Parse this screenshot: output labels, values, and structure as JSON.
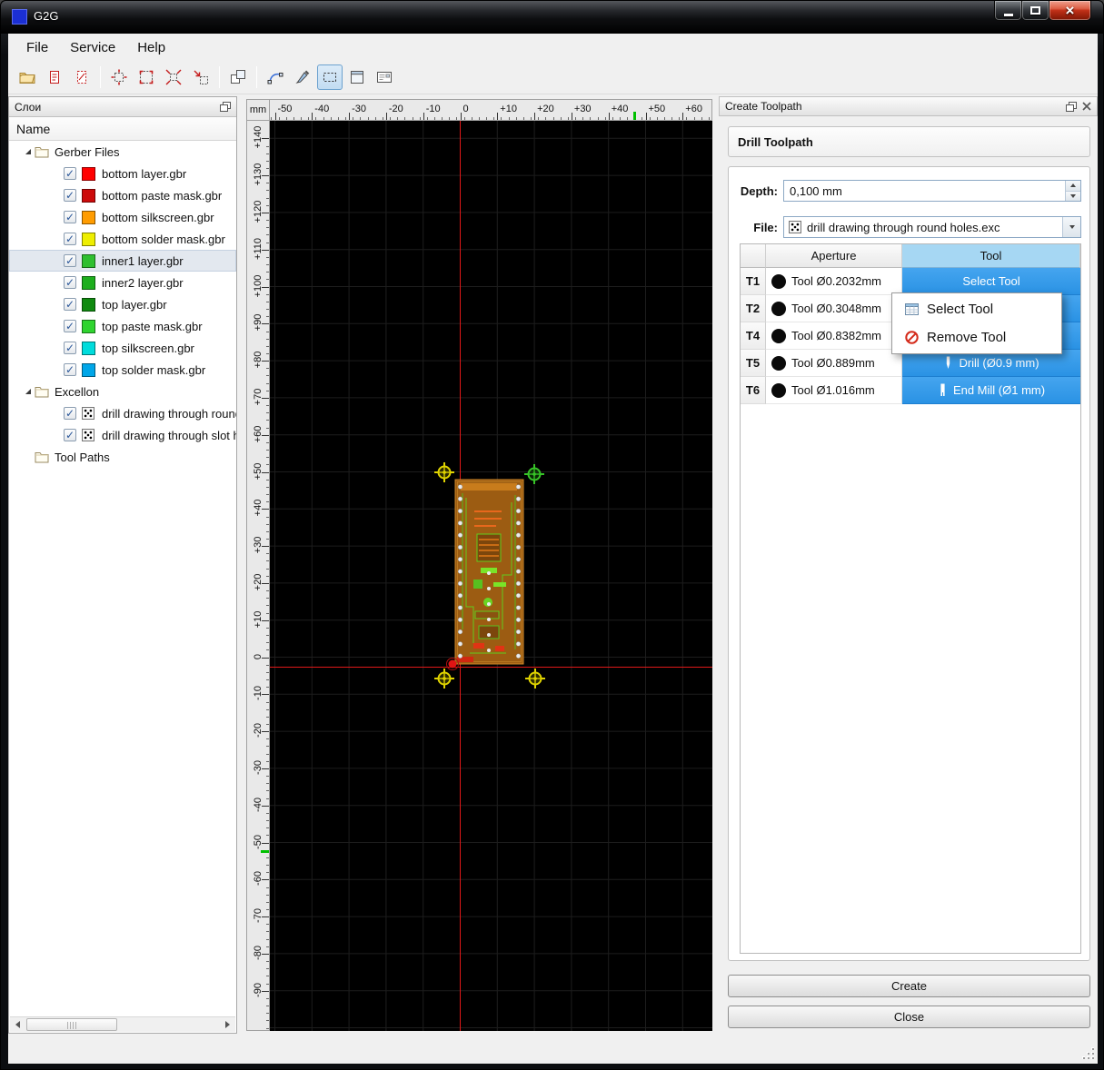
{
  "window": {
    "title": "G2G"
  },
  "menu": {
    "items": [
      "File",
      "Service",
      "Help"
    ]
  },
  "toolbar": {
    "buttons": [
      {
        "name": "open-file-button",
        "icon": "folder"
      },
      {
        "name": "import-gerber-button",
        "icon": "docRed"
      },
      {
        "name": "close-file-button",
        "icon": "docRedDashed"
      },
      {
        "name": "zoom-fit-button",
        "icon": "zoomFit",
        "sep": true
      },
      {
        "name": "zoom-window-button",
        "icon": "zoomWindow"
      },
      {
        "name": "zoom-in-button",
        "icon": "zoomIn"
      },
      {
        "name": "zoom-out-button",
        "icon": "zoomOut"
      },
      {
        "name": "tile-view-button",
        "icon": "tile",
        "sep": true
      },
      {
        "name": "arc-tool-button",
        "icon": "arc",
        "sep": true
      },
      {
        "name": "draw-tool-button",
        "icon": "brush"
      },
      {
        "name": "select-region-button",
        "icon": "marquee",
        "pressed": true
      },
      {
        "name": "frame-view-button",
        "icon": "frame"
      },
      {
        "name": "form-view-button",
        "icon": "form"
      }
    ]
  },
  "layers_panel": {
    "title": "Слои",
    "name_header": "Name",
    "tree": [
      {
        "label": "Gerber Files",
        "type": "folder",
        "expanded": true,
        "children": [
          {
            "label": "bottom layer.gbr",
            "checked": true,
            "swatch": "#ff0000"
          },
          {
            "label": "bottom paste mask.gbr",
            "checked": true,
            "swatch": "#cc0a0a"
          },
          {
            "label": "bottom silkscreen.gbr",
            "checked": true,
            "swatch": "#ff9c00"
          },
          {
            "label": "bottom solder mask.gbr",
            "checked": true,
            "swatch": "#eeee00"
          },
          {
            "label": "inner1 layer.gbr",
            "checked": true,
            "swatch": "#2fbf2f",
            "selected": true
          },
          {
            "label": "inner2 layer.gbr",
            "checked": true,
            "swatch": "#1dae1d"
          },
          {
            "label": "top layer.gbr",
            "checked": true,
            "swatch": "#0f8a0f"
          },
          {
            "label": "top paste mask.gbr",
            "checked": true,
            "swatch": "#2fd42f"
          },
          {
            "label": "top silkscreen.gbr",
            "checked": true,
            "swatch": "#00dcdc"
          },
          {
            "label": "top solder mask.gbr",
            "checked": true,
            "swatch": "#00a6e8"
          }
        ]
      },
      {
        "label": "Excellon",
        "type": "folder",
        "expanded": true,
        "children": [
          {
            "label": "drill drawing through round holes.exc",
            "checked": true,
            "icon": "drill"
          },
          {
            "label": "drill drawing through slot holes.exc",
            "checked": true,
            "icon": "drill"
          }
        ]
      },
      {
        "label": "Tool Paths",
        "type": "folder"
      }
    ]
  },
  "canvas": {
    "unit": "mm",
    "h_ruler": [
      "-50",
      "-40",
      "-30",
      "-20",
      "-10",
      "0",
      "+10",
      "+20",
      "+30",
      "+40",
      "+50",
      "+60"
    ],
    "v_ruler": [
      "+140",
      "+130",
      "+120",
      "+110",
      "+100",
      "+90",
      "+80",
      "+70",
      "+60",
      "+50",
      "+40",
      "+30",
      "+20",
      "+10",
      "0",
      "-10",
      "-20",
      "-30",
      "-40",
      "-50",
      "-60",
      "-70",
      "-80",
      "-90"
    ]
  },
  "toolpath_panel": {
    "title": "Create Toolpath",
    "section_title": "Drill Toolpath",
    "depth_label": "Depth:",
    "depth_value": "0,100 mm",
    "file_label": "File:",
    "file_value": "drill drawing through round holes.exc",
    "table": {
      "aperture_header": "Aperture",
      "tool_header": "Tool",
      "rows": [
        {
          "id": "T1",
          "aperture": "Tool Ø0.2032mm",
          "tool": "Select Tool",
          "tool_icon": ""
        },
        {
          "id": "T2",
          "aperture": "Tool Ø0.3048mm",
          "tool": "",
          "tool_icon": ""
        },
        {
          "id": "T4",
          "aperture": "Tool Ø0.8382mm",
          "tool": "",
          "tool_icon": ""
        },
        {
          "id": "T5",
          "aperture": "Tool Ø0.889mm",
          "tool": "Drill (Ø0.9 mm)",
          "tool_icon": "drill"
        },
        {
          "id": "T6",
          "aperture": "Tool Ø1.016mm",
          "tool": "End Mill (Ø1 mm)",
          "tool_icon": "endmill"
        }
      ]
    },
    "context_menu": {
      "items": [
        {
          "label": "Select Tool",
          "icon": "table"
        },
        {
          "label": "Remove Tool",
          "icon": "forbidden"
        }
      ]
    },
    "create_label": "Create",
    "close_label": "Close"
  }
}
